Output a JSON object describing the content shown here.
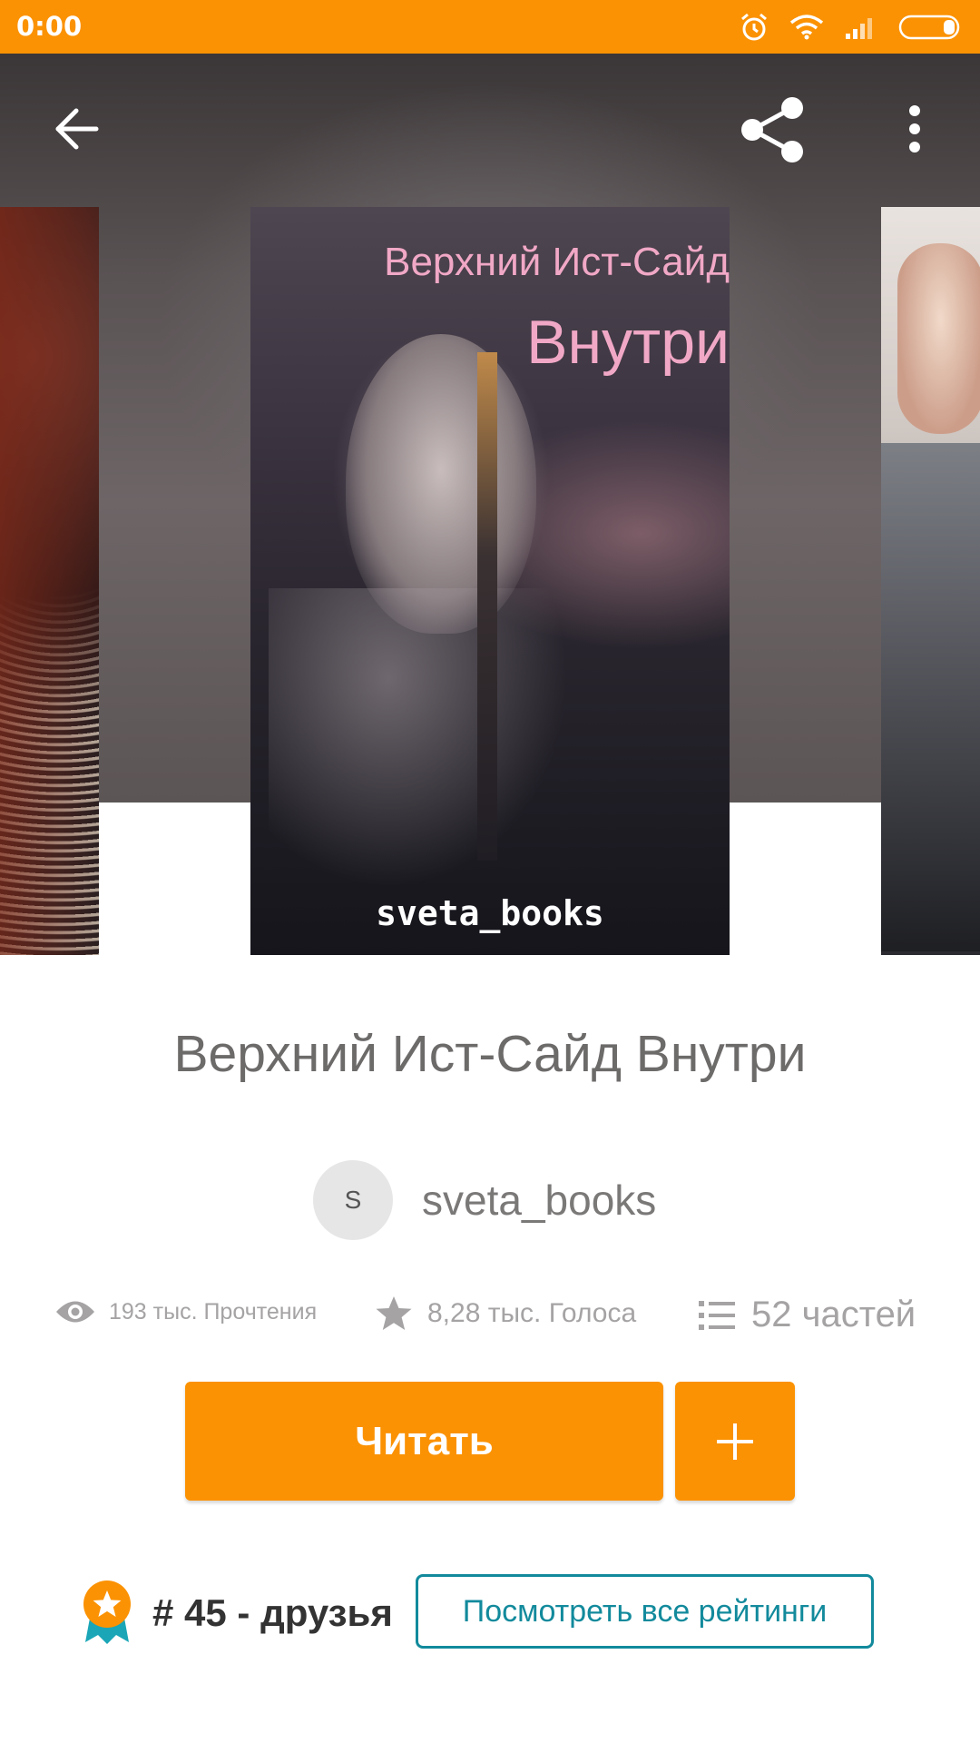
{
  "status_bar": {
    "time": "0:00",
    "bg_color": "#fb9203"
  },
  "toolbar": {
    "back_icon": "arrow-left-icon",
    "share_icon": "share-icon",
    "more_icon": "more-vertical-icon"
  },
  "cover": {
    "title_line1": "Верхний Ист-Сайд",
    "title_line2": "Внутри",
    "author": "sveta_books"
  },
  "book": {
    "title": "Верхний Ист-Сайд Внутри",
    "author_initial": "S",
    "author_name": "sveta_books"
  },
  "stats": {
    "reads": "193 тыс. Прочтения",
    "votes": "8,28 тыс. Голоса",
    "parts": "52 частей"
  },
  "actions": {
    "read_label": "Читать",
    "add_label": "+",
    "accent_color": "#fb9203"
  },
  "ranking": {
    "rank_text": "# 45 - друзья",
    "view_all_label": "Посмотреть все рейтинги",
    "link_color": "#128a9c"
  }
}
